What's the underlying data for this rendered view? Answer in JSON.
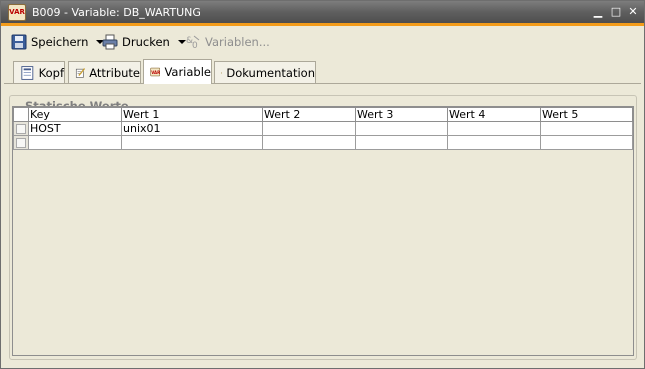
{
  "window": {
    "icon_text": "VAR",
    "title": "B009 - Variable: DB_WARTUNG",
    "minimize": "▁",
    "restore": "□",
    "close": "✕",
    "accent_color": "#f39c1a"
  },
  "toolbar": {
    "save_label": "Speichern",
    "print_label": "Drucken",
    "variables_label": "Variablen..."
  },
  "tabs": [
    {
      "label": "Kopf",
      "icon": "header-icon"
    },
    {
      "label": "Attribute",
      "icon": "attributes-icon"
    },
    {
      "label": "Variable",
      "icon": "variable-icon",
      "active": true
    },
    {
      "label": "Dokumentation",
      "icon": "documentation-icon"
    }
  ],
  "group": {
    "title": "Statische Werte"
  },
  "grid": {
    "columns": [
      "Key",
      "Wert 1",
      "Wert 2",
      "Wert 3",
      "Wert 4",
      "Wert 5"
    ],
    "rows": [
      [
        "HOST",
        "unix01",
        "",
        "",
        "",
        ""
      ],
      [
        "",
        "",
        "",
        "",
        "",
        ""
      ]
    ]
  }
}
